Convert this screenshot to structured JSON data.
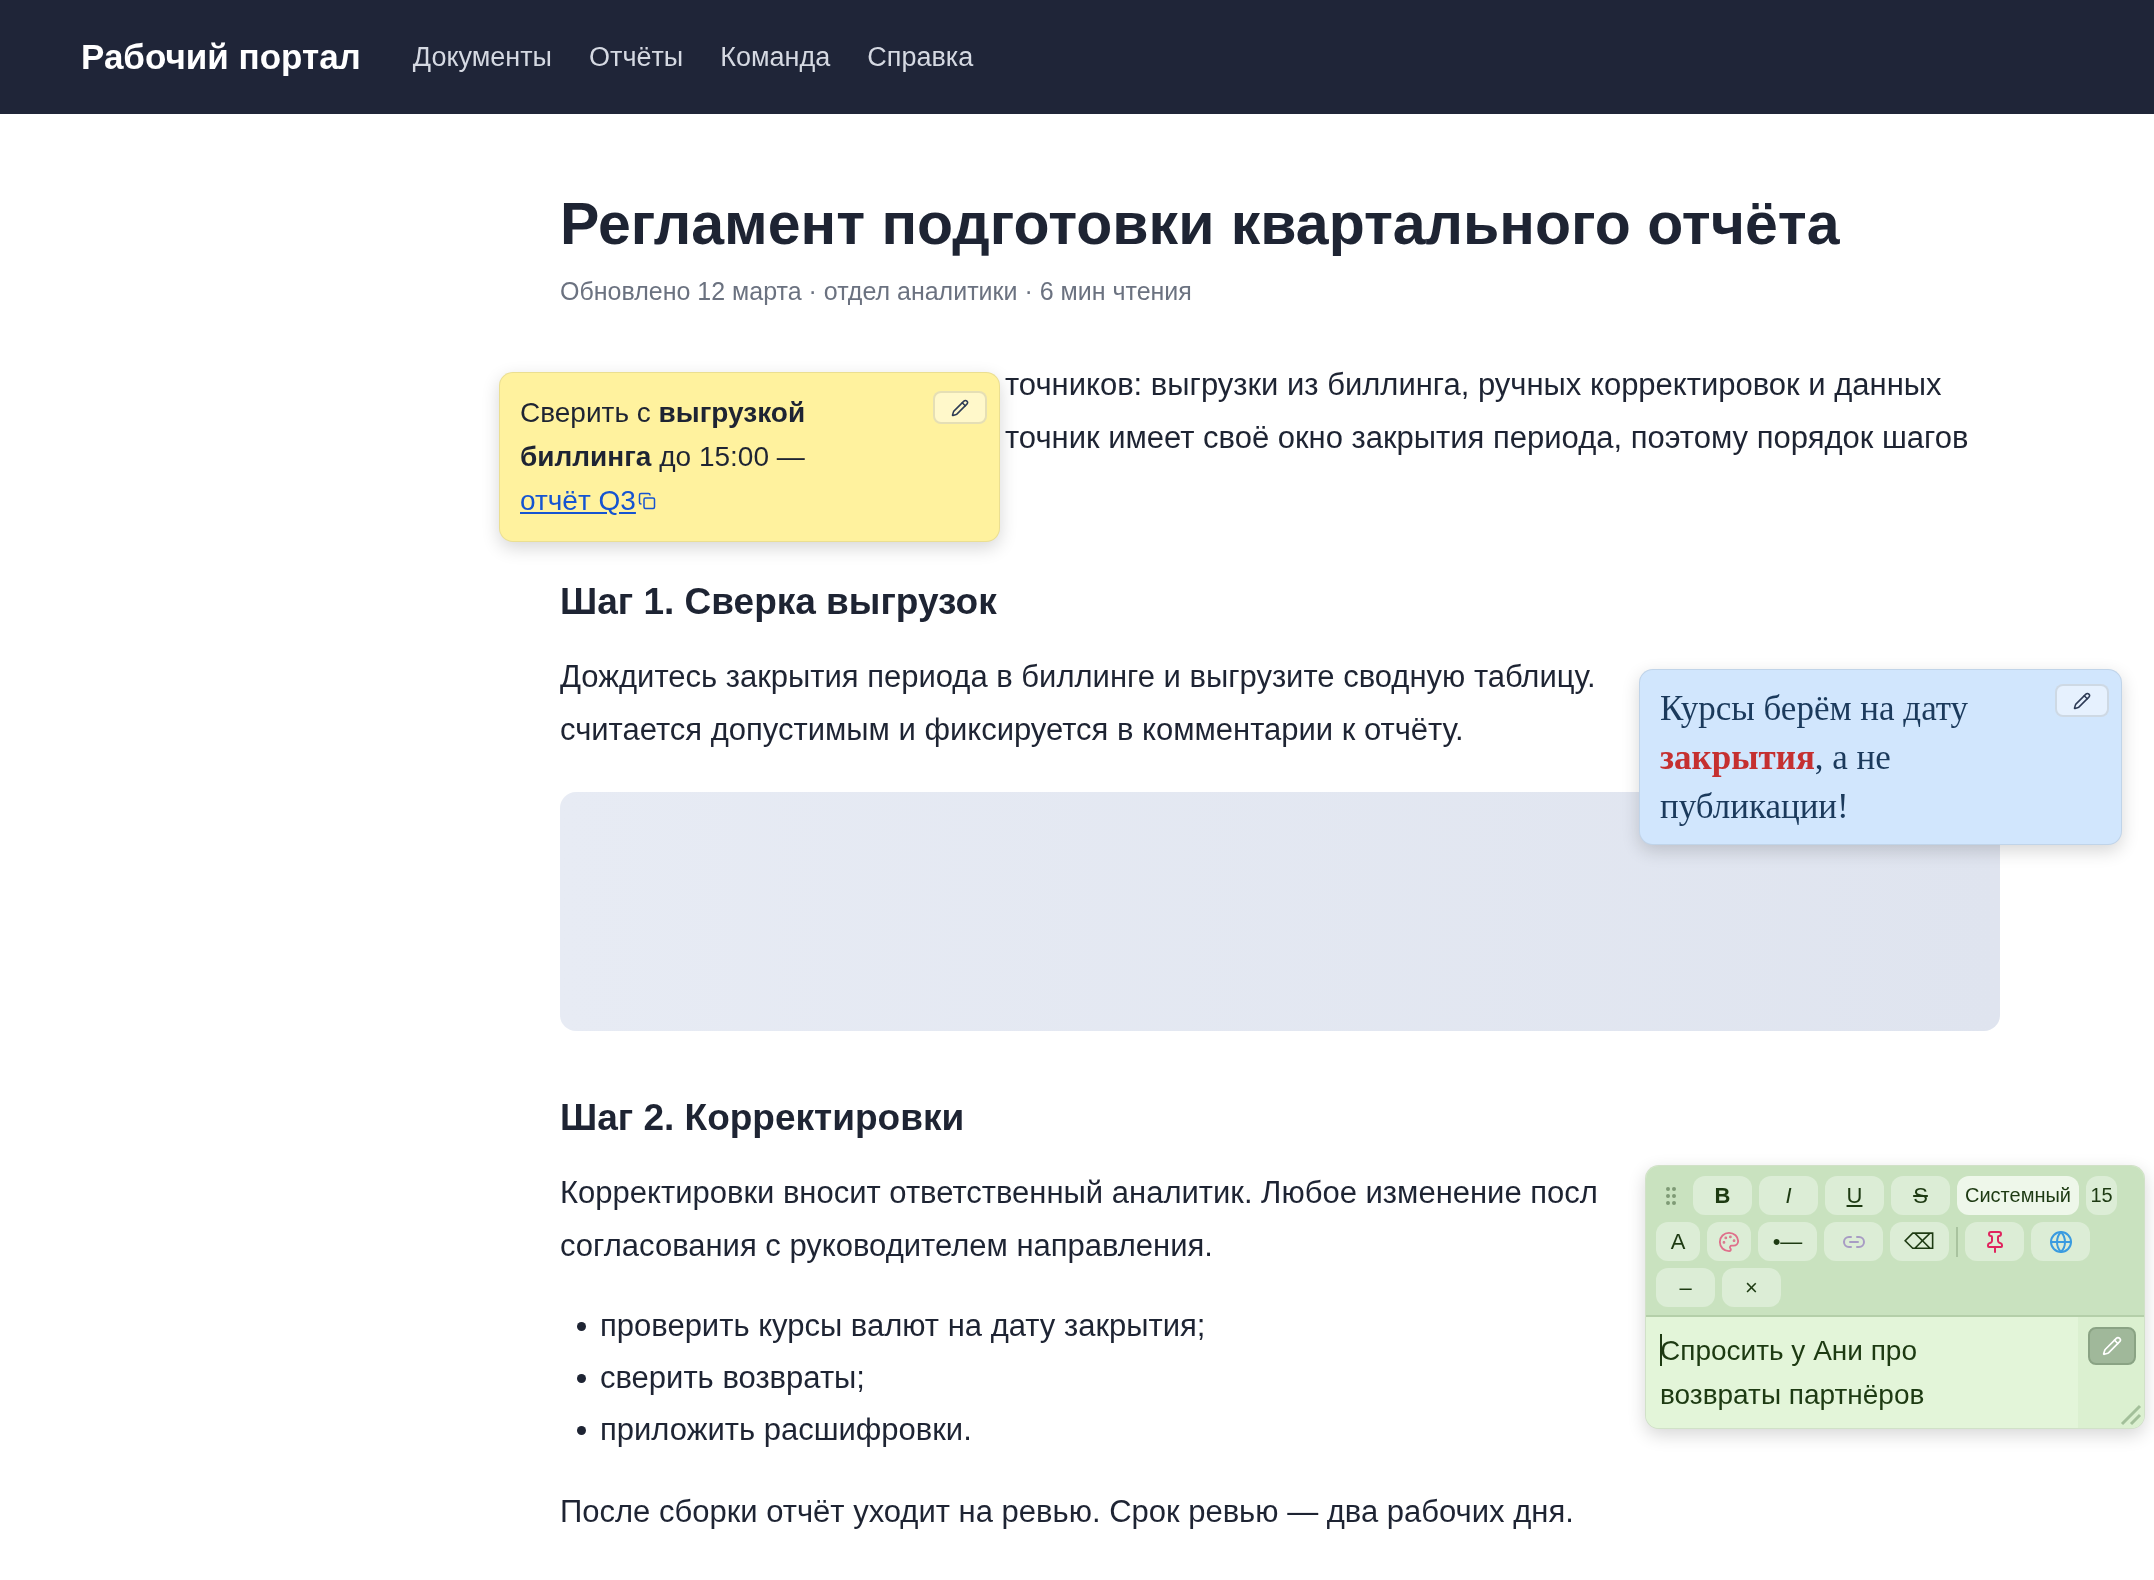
{
  "nav": {
    "brand": "Рабочий портал",
    "links": [
      "Документы",
      "Отчёты",
      "Команда",
      "Справка"
    ]
  },
  "article": {
    "title": "Регламент подготовки квартального отчёта",
    "meta": "Обновлено 12 марта · отдел аналитики · 6 мин чтения",
    "intro_lines": [
      "точников: выгрузки из биллинга, ручных корректировок и данных",
      "точник имеет своё окно закрытия периода, поэтому порядок шагов"
    ],
    "sections": [
      {
        "heading": "Шаг 1. Сверка выгрузок",
        "lines": [
          "Дождитесь закрытия периода в биллинге и выгрузите сводную таблицу.",
          "считается допустимым и фиксируется в комментарии к отчёту."
        ],
        "figure": {
          "kind": "placeholder"
        }
      },
      {
        "heading": "Шаг 2. Корректировки",
        "lines": [
          "Корректировки вносит ответственный аналитик. Любое изменение посл",
          "согласования с руководителем направления."
        ],
        "bullets": [
          "проверить курсы валют на дату закрытия;",
          "сверить возвраты;",
          "приложить расшифровки."
        ],
        "after": "После сборки отчёт уходит на ревью. Срок ревью — два рабочих дня."
      }
    ]
  },
  "notes": [
    {
      "kind": "sticky",
      "color": "#fff29e",
      "text": "Сверить с **выгрузкой биллинга** до 15:00 — ",
      "link": "отчёт Q3"
    },
    {
      "kind": "serif",
      "color": "#d1e6fd",
      "text": "Курсы берём на дату **закрытия**, а не публикации!"
    },
    {
      "kind": "editor",
      "color": "#e3f5d9",
      "value": "Спросить у Ани про возвраты партнёров",
      "toolbar": [
        [
          {
            "kind": "handle"
          },
          {
            "kind": "bold",
            "label": "B"
          },
          {
            "kind": "italic",
            "label": "I"
          },
          {
            "kind": "underline",
            "label": "U"
          },
          {
            "kind": "strike",
            "label": "S"
          },
          {
            "kind": "select",
            "label": "Системный"
          },
          {
            "kind": "size",
            "label": "15"
          }
        ],
        [
          {
            "kind": "narrow",
            "label": "A"
          },
          {
            "kind": "palette"
          },
          {
            "kind": "text",
            "label": "•—"
          },
          {
            "kind": "link"
          },
          {
            "kind": "text",
            "label": "⌫"
          },
          {
            "kind": "separator"
          },
          {
            "kind": "pin"
          },
          {
            "kind": "globe"
          }
        ],
        [
          {
            "kind": "text",
            "label": "–"
          },
          {
            "kind": "text",
            "label": "×"
          }
        ]
      ]
    }
  ]
}
